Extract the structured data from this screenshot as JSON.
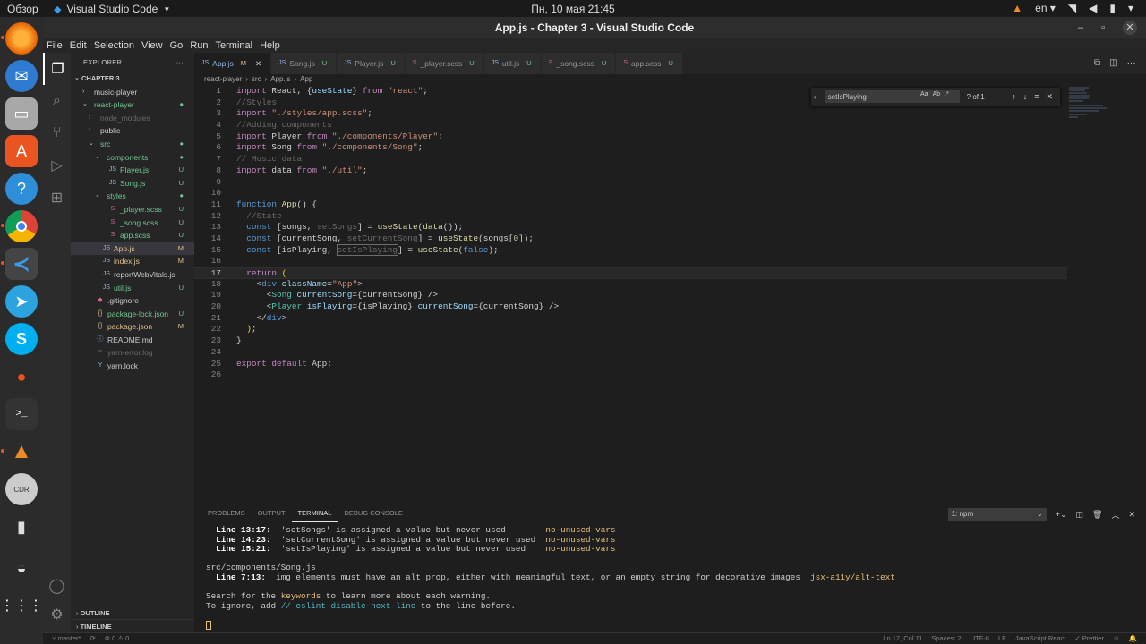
{
  "top_bar": {
    "overview": "Обзор",
    "app_name": "Visual Studio Code",
    "clock": "Пн, 10 мая  21:45",
    "lang": "en"
  },
  "window": {
    "title": "App.js - Chapter 3 - Visual Studio Code"
  },
  "menu": [
    "File",
    "Edit",
    "Selection",
    "View",
    "Go",
    "Run",
    "Terminal",
    "Help"
  ],
  "explorer": {
    "header": "EXPLORER",
    "section": "CHAPTER 3",
    "tree": [
      {
        "label": "music-player",
        "depth": 1,
        "kind": "folder",
        "open": false,
        "cls": "",
        "status": ""
      },
      {
        "label": "react-player",
        "depth": 1,
        "kind": "folder",
        "open": true,
        "cls": "c-new",
        "status": "●"
      },
      {
        "label": "node_modules",
        "depth": 2,
        "kind": "folder",
        "open": false,
        "cls": "c-dim",
        "status": ""
      },
      {
        "label": "public",
        "depth": 2,
        "kind": "folder",
        "open": false,
        "cls": "",
        "status": ""
      },
      {
        "label": "src",
        "depth": 2,
        "kind": "folder",
        "open": true,
        "cls": "c-new",
        "status": "●"
      },
      {
        "label": "components",
        "depth": 3,
        "kind": "folder",
        "open": true,
        "cls": "c-new",
        "status": "●"
      },
      {
        "label": "Player.js",
        "depth": 4,
        "kind": "js",
        "cls": "c-new",
        "status": "U"
      },
      {
        "label": "Song.js",
        "depth": 4,
        "kind": "js",
        "cls": "c-new",
        "status": "U"
      },
      {
        "label": "styles",
        "depth": 3,
        "kind": "folder",
        "open": true,
        "cls": "c-new",
        "status": "●"
      },
      {
        "label": "_player.scss",
        "depth": 4,
        "kind": "sass",
        "cls": "c-new",
        "status": "U"
      },
      {
        "label": "_song.scss",
        "depth": 4,
        "kind": "sass",
        "cls": "c-new",
        "status": "U"
      },
      {
        "label": "app.scss",
        "depth": 4,
        "kind": "sass",
        "cls": "c-new",
        "status": "U"
      },
      {
        "label": "App.js",
        "depth": 3,
        "kind": "js",
        "cls": "c-mod",
        "status": "M"
      },
      {
        "label": "index.js",
        "depth": 3,
        "kind": "js",
        "cls": "c-mod",
        "status": "M"
      },
      {
        "label": "reportWebVitals.js",
        "depth": 3,
        "kind": "js",
        "cls": "",
        "status": ""
      },
      {
        "label": "util.js",
        "depth": 3,
        "kind": "js",
        "cls": "c-new",
        "status": "U"
      },
      {
        "label": ".gitignore",
        "depth": 2,
        "kind": "git",
        "cls": "",
        "status": ""
      },
      {
        "label": "package-lock.json",
        "depth": 2,
        "kind": "json",
        "cls": "c-new",
        "status": "U"
      },
      {
        "label": "package.json",
        "depth": 2,
        "kind": "json",
        "cls": "c-mod",
        "status": "M"
      },
      {
        "label": "README.md",
        "depth": 2,
        "kind": "info",
        "cls": "",
        "status": ""
      },
      {
        "label": "yarn-error.log",
        "depth": 2,
        "kind": "log",
        "cls": "c-dim",
        "status": ""
      },
      {
        "label": "yarn.lock",
        "depth": 2,
        "kind": "yarn",
        "cls": "",
        "status": ""
      }
    ],
    "outline": "OUTLINE",
    "timeline": "TIMELINE"
  },
  "tabs": [
    {
      "label": "App.js",
      "mark": "M",
      "active": true,
      "kind": "js"
    },
    {
      "label": "Song.js",
      "mark": "U",
      "active": false,
      "kind": "js"
    },
    {
      "label": "Player.js",
      "mark": "U",
      "active": false,
      "kind": "js"
    },
    {
      "label": "_player.scss",
      "mark": "U",
      "active": false,
      "kind": "sass"
    },
    {
      "label": "util.js",
      "mark": "U",
      "active": false,
      "kind": "js"
    },
    {
      "label": "_song.scss",
      "mark": "U",
      "active": false,
      "kind": "sass"
    },
    {
      "label": "app.scss",
      "mark": "U",
      "active": false,
      "kind": "sass"
    }
  ],
  "breadcrumbs": [
    "react-player",
    "src",
    "App.js",
    "App"
  ],
  "find": {
    "query": "setIsPlaying",
    "result": "? of 1"
  },
  "editor": {
    "current_line": 17,
    "lines": [
      [
        [
          "k",
          "import "
        ],
        [
          "d",
          "React, {"
        ],
        [
          "v",
          "useState"
        ],
        [
          "d",
          "} "
        ],
        [
          "k",
          "from "
        ],
        [
          "s",
          "\"react\""
        ],
        [
          "d",
          ";"
        ]
      ],
      [
        [
          "ct",
          "//Styles"
        ]
      ],
      [
        [
          "k",
          "import "
        ],
        [
          "s",
          "\"./styles/app.scss\""
        ],
        [
          "d",
          ";"
        ]
      ],
      [
        [
          "ct",
          "//Adding components"
        ]
      ],
      [
        [
          "k",
          "import "
        ],
        [
          "d",
          "Player "
        ],
        [
          "k",
          "from "
        ],
        [
          "s",
          "\"./components/Player\""
        ],
        [
          "d",
          ";"
        ]
      ],
      [
        [
          "k",
          "import "
        ],
        [
          "d",
          "Song "
        ],
        [
          "k",
          "from "
        ],
        [
          "s",
          "\"./components/Song\""
        ],
        [
          "d",
          ";"
        ]
      ],
      [
        [
          "ct",
          "// Music data"
        ]
      ],
      [
        [
          "k",
          "import "
        ],
        [
          "d",
          "data "
        ],
        [
          "k",
          "from "
        ],
        [
          "s",
          "\"./util\""
        ],
        [
          "d",
          ";"
        ]
      ],
      [],
      [],
      [
        [
          "kb",
          "function "
        ],
        [
          "f",
          "App"
        ],
        [
          "d",
          "() {"
        ]
      ],
      [
        [
          "d",
          "  "
        ],
        [
          "ct",
          "//State"
        ]
      ],
      [
        [
          "d",
          "  "
        ],
        [
          "kb",
          "const "
        ],
        [
          "d",
          "[songs, "
        ],
        [
          "ct",
          "setSongs"
        ],
        [
          "d",
          "] = "
        ],
        [
          "f",
          "useState"
        ],
        [
          "d",
          "("
        ],
        [
          "f",
          "data"
        ],
        [
          "d",
          "());"
        ]
      ],
      [
        [
          "d",
          "  "
        ],
        [
          "kb",
          "const "
        ],
        [
          "d",
          "[currentSong, "
        ],
        [
          "ct",
          "setCurrentSong"
        ],
        [
          "d",
          "] = "
        ],
        [
          "f",
          "useState"
        ],
        [
          "d",
          "(songs["
        ],
        [
          "n",
          "0"
        ],
        [
          "d",
          "]);"
        ]
      ],
      [
        [
          "d",
          "  "
        ],
        [
          "kb",
          "const "
        ],
        [
          "d",
          "[isPlaying, "
        ],
        [
          "ct",
          "setIsPlaying"
        ],
        [
          "d",
          "] = "
        ],
        [
          "f",
          "useState"
        ],
        [
          "d",
          "("
        ],
        [
          "kb",
          "false"
        ],
        [
          "d",
          ");"
        ]
      ],
      [],
      [
        [
          "d",
          "  "
        ],
        [
          "k",
          "return "
        ],
        [
          "y",
          "("
        ]
      ],
      [
        [
          "d",
          "    <"
        ],
        [
          "tg",
          "div "
        ],
        [
          "at",
          "className"
        ],
        [
          "d",
          "="
        ],
        [
          "s",
          "\"App\""
        ],
        [
          "d",
          ">"
        ]
      ],
      [
        [
          "d",
          "      <"
        ],
        [
          "t",
          "Song "
        ],
        [
          "at",
          "currentSong"
        ],
        [
          "d",
          "={currentSong} />"
        ]
      ],
      [
        [
          "d",
          "      <"
        ],
        [
          "t",
          "Player "
        ],
        [
          "at",
          "isPlaying"
        ],
        [
          "d",
          "={isPlaying} "
        ],
        [
          "at",
          "currentSong"
        ],
        [
          "d",
          "={currentSong} />"
        ]
      ],
      [
        [
          "d",
          "    </"
        ],
        [
          "tg",
          "div"
        ],
        [
          "d",
          ">"
        ]
      ],
      [
        [
          "d",
          "  "
        ],
        [
          "y",
          ")"
        ],
        [
          "d",
          ";"
        ]
      ],
      [
        [
          "d",
          "}"
        ]
      ],
      [],
      [
        [
          "k",
          "export default "
        ],
        [
          "d",
          "App;"
        ]
      ],
      []
    ]
  },
  "panel": {
    "tabs": [
      {
        "label": "PROBLEMS",
        "active": false
      },
      {
        "label": "OUTPUT",
        "active": false
      },
      {
        "label": "TERMINAL",
        "active": true
      },
      {
        "label": "DEBUG CONSOLE",
        "active": false
      }
    ],
    "terminal_select": "1: npm",
    "terminal_lines": [
      [
        [
          "b",
          "  Line 13:17:"
        ],
        [
          "",
          "  'setSongs' is assigned a value but never used        "
        ],
        [
          "yl",
          "no-unused-vars"
        ]
      ],
      [
        [
          "b",
          "  Line 14:23:"
        ],
        [
          "",
          "  'setCurrentSong' is assigned a value but never used  "
        ],
        [
          "yl",
          "no-unused-vars"
        ]
      ],
      [
        [
          "b",
          "  Line 15:21:"
        ],
        [
          "",
          "  'setIsPlaying' is assigned a value but never used    "
        ],
        [
          "yl",
          "no-unused-vars"
        ]
      ],
      [],
      [
        [
          "",
          "src/components/Song.js"
        ]
      ],
      [
        [
          "b",
          "  Line 7:13:"
        ],
        [
          "",
          "  img elements must have an alt prop, either with meaningful text, or an empty string for decorative images  "
        ],
        [
          "yl",
          "jsx-a11y/alt-text"
        ]
      ],
      [],
      [
        [
          "",
          "Search for the "
        ],
        [
          "yl",
          "keywords"
        ],
        [
          "",
          "",
          " to learn more about each warning."
        ]
      ],
      [
        [
          "",
          "To ignore, add "
        ],
        [
          "cy",
          "// eslint-disable-next-line"
        ],
        [
          "",
          "",
          " to the line before."
        ]
      ],
      []
    ]
  },
  "status": {
    "branch": "master*",
    "sync": "⊗ 0 ⚠ 0",
    "position": "Ln 17, Col 11",
    "spaces": "Spaces: 2",
    "encoding": "UTF-8",
    "eol": "LF",
    "language": "JavaScript React",
    "formatter": "✓ Prettier"
  }
}
